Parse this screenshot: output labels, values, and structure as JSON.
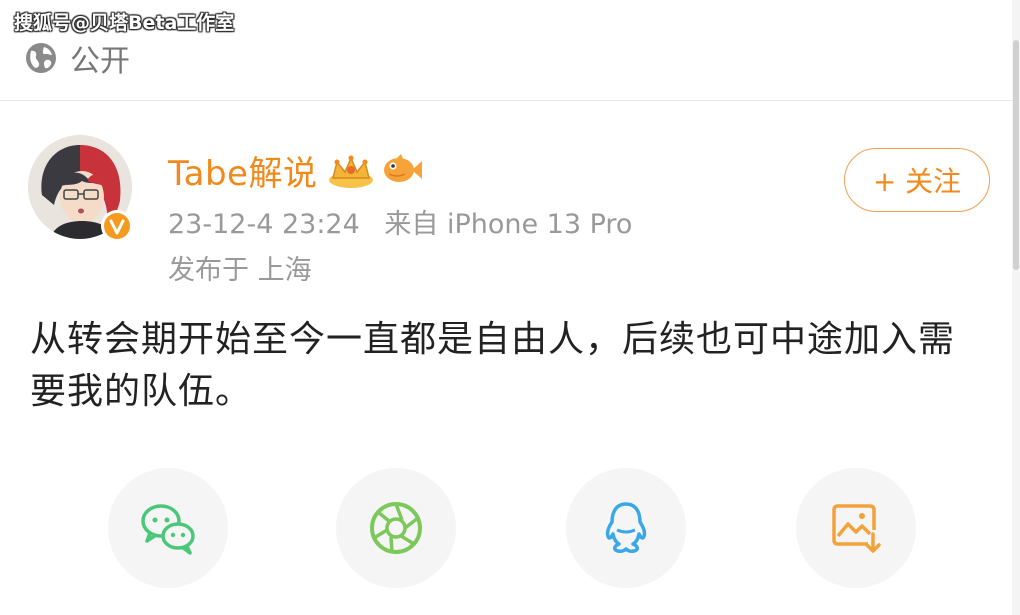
{
  "watermark": "搜狐号@贝塔Beta工作室",
  "visibility": {
    "label": "公开",
    "icon": "globe-icon"
  },
  "post": {
    "username": "Tabe解说",
    "badges": [
      "crown-icon",
      "fish-icon"
    ],
    "timestamp": "23-12-4 23:24",
    "source": "来自 iPhone 13 Pro",
    "location": "发布于 上海",
    "follow_label": "+ 关注",
    "content": "从转会期开始至今一直都是自由人，后续也可中途加入需要我的队伍。"
  },
  "share": {
    "items": [
      {
        "name": "wechat-icon",
        "color": "#4cc77a"
      },
      {
        "name": "moments-icon",
        "color": "#7cc85a"
      },
      {
        "name": "qq-icon",
        "color": "#3aa8e8"
      },
      {
        "name": "save-image-icon",
        "color": "#f3a23a"
      }
    ]
  },
  "colors": {
    "accent": "#f08a1c",
    "muted": "#999999"
  }
}
